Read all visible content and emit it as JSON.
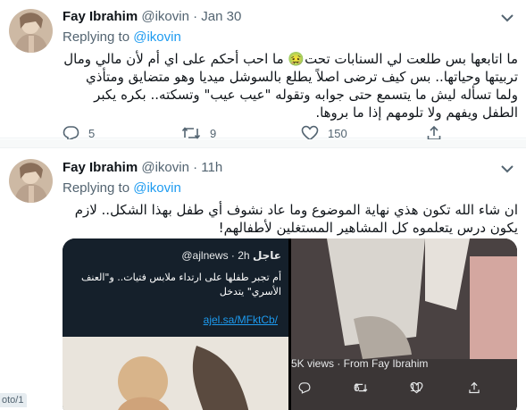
{
  "tweets": [
    {
      "author_name": "Fay Ibrahim",
      "author_handle": "@ikovin",
      "separator": "·",
      "time": "Jan 30",
      "replying_to_prefix": "Replying to",
      "replying_to_handle": "@ikovin",
      "text": "ما اتابعها بس طلعت لي السنابات تحت🤢 ما احب أحكم على اي أم لأن مالي ومال تربيتها وحياتها.. بس كيف ترضى اصلاً يطلع بالسوشل ميديا وهو متضايق ومتأذي ولما تسأله ليش ما يتسمع حتى جوابه وتقوله \"عيب عيب\" وتسكته.. بكره يكبر الطفل ويفهم ولا تلومهم إذا ما بروها.",
      "replies": "5",
      "retweets": "9",
      "likes": "150"
    },
    {
      "author_name": "Fay Ibrahim",
      "author_handle": "@ikovin",
      "separator": "·",
      "time": "11h",
      "replying_to_prefix": "Replying to",
      "replying_to_handle": "@ikovin",
      "text": "ان شاء الله تكون هذي نهاية الموضوع وما عاد نشوف أي طفل بهذا الشكل.. لازم يكون درس يتعلموه كل المشاهير المستغلين لأطفالهم!",
      "media": {
        "embedded_handle": "@ajlnews · 2h",
        "embedded_name": "عاجل",
        "embedded_text": "أم تجبر طفلها على ارتداء ملابس فتيات.. و\"العنف الأسري\" يتدخل",
        "embedded_link": "ajel.sa/MFktCb/",
        "views": "5K views · From Fay Ibrahim",
        "embedded_retweets": "6",
        "embedded_likes": "11"
      }
    }
  ],
  "edge_label": "oto/1",
  "colors": {
    "accent": "#1d9bf0",
    "secondary_text": "#536471",
    "divider": "#eff3f4"
  },
  "icons": [
    "chevron-down-icon",
    "reply-icon",
    "retweet-icon",
    "like-icon",
    "share-icon"
  ]
}
